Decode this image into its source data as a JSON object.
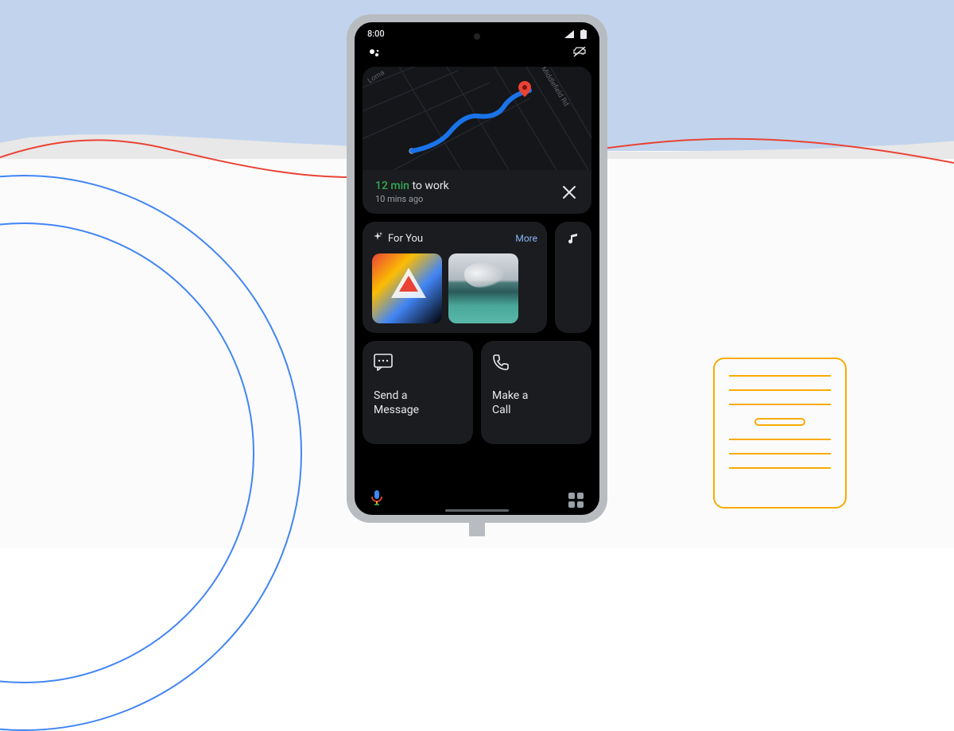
{
  "status_bar": {
    "time": "8:00"
  },
  "map": {
    "street_loma": "Loma",
    "street_middlefield": "Middlefield Rd",
    "eta_time": "12 min",
    "eta_dest": "to work",
    "timestamp": "10 mins ago"
  },
  "for_you": {
    "title": "For You",
    "more_label": "More"
  },
  "actions": {
    "message_label": "Send a\nMessage",
    "call_label": "Make a\nCall"
  },
  "colors": {
    "accent_blue": "#4285f4",
    "accent_red": "#ea4335",
    "accent_yellow": "#fbbc04",
    "accent_green": "#34a853",
    "link_blue": "#8ab4f8"
  }
}
